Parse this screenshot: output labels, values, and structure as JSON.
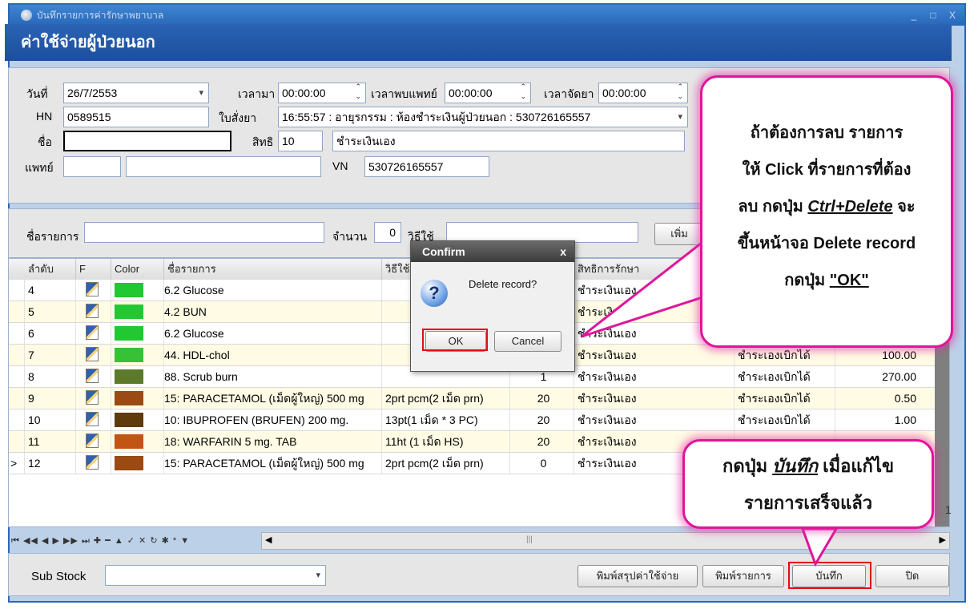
{
  "window": {
    "title": "บันทึกรายการค่ารักษาพยาบาล",
    "controls": [
      "_",
      "□",
      "X"
    ]
  },
  "header": {
    "title": "ค่าใช้จ่ายผู้ป่วยนอก"
  },
  "form": {
    "date_label": "วันที่",
    "date_value": "26/7/2553",
    "time_label": "เวลามา",
    "time_value": "00:00:00",
    "doctor_time_label": "เวลาพบแพทย์",
    "doctor_time_value": "00:00:00",
    "dispense_time_label": "เวลาจัดยา",
    "dispense_time_value": "00:00:00",
    "hn_label": "HN",
    "hn_value": "0589515",
    "order_label": "ใบสั่งยา",
    "order_value": "16:55:57 : อายุรกรรม : ห้องชำระเงินผู้ป่วยนอก : 530726165557",
    "name_label": "ชื่อ",
    "name_value": "",
    "right_label": "สิทธิ",
    "right_code": "10",
    "right_name": "ชำระเงินเอง",
    "doctor_label": "แพทย์",
    "doctor_code": "",
    "doctor_name": "",
    "vn_label": "VN",
    "vn_value": "530726165557"
  },
  "entry": {
    "item_label": "ชื่อรายการ",
    "item_value": "",
    "qty_label": "จำนวน",
    "qty_value": "0",
    "usage_label": "วิธีใช้",
    "usage_value": "",
    "add_button": "เพิ่ม"
  },
  "grid": {
    "columns": [
      "ลำดับ",
      "F",
      "Color",
      "ชื่อรายการ",
      "วิธีใช้",
      "สิทธิการรักษา"
    ],
    "rows": [
      {
        "no": "4",
        "color": "#22c832",
        "name": "6.2 Glucose",
        "usage": "",
        "qty": "",
        "right": "ชำระเงินเอง",
        "claim": "",
        "price": ""
      },
      {
        "no": "5",
        "color": "#22c832",
        "name": "4.2 BUN",
        "usage": "",
        "qty": "",
        "right": "ชำระเงินเอง",
        "claim": "",
        "price": ""
      },
      {
        "no": "6",
        "color": "#22c832",
        "name": "6.2 Glucose",
        "usage": "",
        "qty": "",
        "right": "ชำระเงินเอง",
        "claim": "",
        "price": ""
      },
      {
        "no": "7",
        "color": "#36c234",
        "name": "44. HDL-chol",
        "usage": "",
        "qty": "",
        "right": "ชำระเงินเอง",
        "claim": "ชำระเองเบิกได้",
        "price": "100.00"
      },
      {
        "no": "8",
        "color": "#5c7a2a",
        "name": "88. Scrub burn",
        "usage": "",
        "qty": "1",
        "right": "ชำระเงินเอง",
        "claim": "ชำระเองเบิกได้",
        "price": "270.00"
      },
      {
        "no": "9",
        "color": "#9a4a12",
        "name": "15: PARACETAMOL (เม็ดผู้ใหญ่) 500 mg",
        "usage": "2prt pcm(2 เม็ด prn)",
        "qty": "20",
        "right": "ชำระเงินเอง",
        "claim": "ชำระเองเบิกได้",
        "price": "0.50"
      },
      {
        "no": "10",
        "color": "#5e3a0c",
        "name": "10: IBUPROFEN (BRUFEN) 200 mg.",
        "usage": "13pt(1 เม็ด * 3 PC)",
        "qty": "20",
        "right": "ชำระเงินเอง",
        "claim": "ชำระเองเบิกได้",
        "price": "1.00"
      },
      {
        "no": "11",
        "color": "#c25416",
        "name": "18: WARFARIN 5 mg. TAB",
        "usage": "11ht (1 เม็ด HS)",
        "qty": "20",
        "right": "ชำระเงินเอง",
        "claim": "",
        "price": ""
      },
      {
        "no": "12",
        "color": "#9a4a12",
        "name": "15: PARACETAMOL (เม็ดผู้ใหญ่) 500 mg",
        "usage": "2prt pcm(2 เม็ด prn)",
        "qty": "0",
        "right": "ชำระเงินเอง",
        "claim": "",
        "price": ""
      }
    ],
    "current_row_marker": ">",
    "navigator": "⏮ ◀◀ ◀ ▶ ▶▶ ⏭ ✚ ━ ▲ ✓ ✕ ↻ ✱ * ▼",
    "footer_value": "1"
  },
  "dialog": {
    "title": "Confirm",
    "close": "x",
    "icon": "question-icon",
    "icon_glyph": "?",
    "message": "Delete record?",
    "ok": "OK",
    "cancel": "Cancel"
  },
  "bottom": {
    "substock_label": "Sub Stock",
    "substock_value": "",
    "print_summary": "พิมพ์สรุปค่าใช้จ่าย",
    "print_list": "พิมพ์รายการ",
    "save": "บันทึก",
    "close": "ปิด"
  },
  "callouts": {
    "delete_line1": "ถ้าต้องการลบ รายการ",
    "delete_line2": "ให้ Click ที่รายการที่ต้อง",
    "delete_line3_pre": "ลบ กดปุ่ม ",
    "delete_line3_key": "Ctrl+Delete",
    "delete_line3_post": " จะ",
    "delete_line4": "ขึ้นหน้าจอ Delete record",
    "delete_line5_pre": "กดปุ่ม ",
    "delete_line5_ok": "\"OK\"",
    "save_line1_pre": "กดปุ่ม ",
    "save_line1_key": "บันทึก",
    "save_line1_post": " เมื่อแก้ไข",
    "save_line2": "รายการเสร็จแล้ว"
  },
  "colors": {
    "callout_border": "#e0159a",
    "highlight_box": "#e01010",
    "header_blue": "#1c4f9c"
  }
}
